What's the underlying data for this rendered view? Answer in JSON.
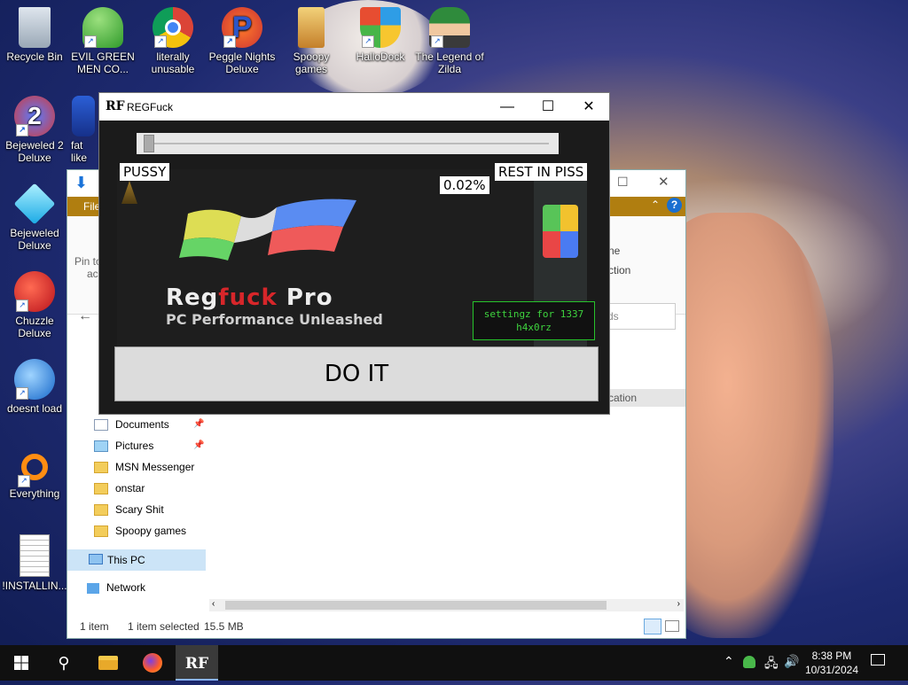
{
  "desktop": {
    "icons": [
      {
        "label": "Recycle Bin",
        "icon": "recycle-bin-icon"
      },
      {
        "label": "EVIL GREEN MEN CO...",
        "icon": "msn-people-icon"
      },
      {
        "label": "literally unusable",
        "icon": "chrome-icon"
      },
      {
        "label": "Peggle Nights Deluxe",
        "icon": "peggle-icon"
      },
      {
        "label": "Spoopy games",
        "icon": "folder-icon"
      },
      {
        "label": "HalloDock",
        "icon": "shield-icon"
      },
      {
        "label": "The Legend of Zilda",
        "icon": "zelda-icon"
      },
      {
        "label": "Bejeweled 2 Deluxe",
        "icon": "bejeweled2-icon"
      },
      {
        "label": "fat like",
        "icon": "music-icon"
      },
      {
        "label": "Bejeweled Deluxe",
        "icon": "diamond-icon"
      },
      {
        "label": "Chuzzle Deluxe",
        "icon": "chuzzle-icon"
      },
      {
        "label": "doesnt load",
        "icon": "thunderbird-icon"
      },
      {
        "label": "Everything",
        "icon": "magnifier-icon"
      },
      {
        "label": "!INSTALLIN...",
        "icon": "text-file-icon"
      }
    ]
  },
  "explorer": {
    "ribbon_tab": "File",
    "ribbon_fragments": [
      "Pin to",
      "acc",
      "ne",
      "ction"
    ],
    "search_fragment": "ds",
    "column_fragment": "cation",
    "nav": [
      "Documents",
      "Pictures",
      "MSN Messenger",
      "onstar",
      "Scary Shit",
      "Spoopy games",
      "This PC",
      "Network"
    ],
    "status_items": "1 item",
    "status_selected": "1 item selected",
    "status_size": "15.5 MB"
  },
  "app": {
    "logo": "RF",
    "title": "REGFuck",
    "left_label": "PUSSY",
    "right_label": "REST IN PISS",
    "percent": "0.02%",
    "brand_part1": "Reg",
    "brand_part2": "fuck",
    "brand_part3": " Pro",
    "tagline": "PC Performance Unleashed",
    "settings_line1": "settingz for 1337",
    "settings_line2": "h4x0rz",
    "action_button": "DO IT",
    "slider_value": 0.0002
  },
  "taskbar": {
    "time": "8:38 PM",
    "date": "10/31/2024"
  }
}
